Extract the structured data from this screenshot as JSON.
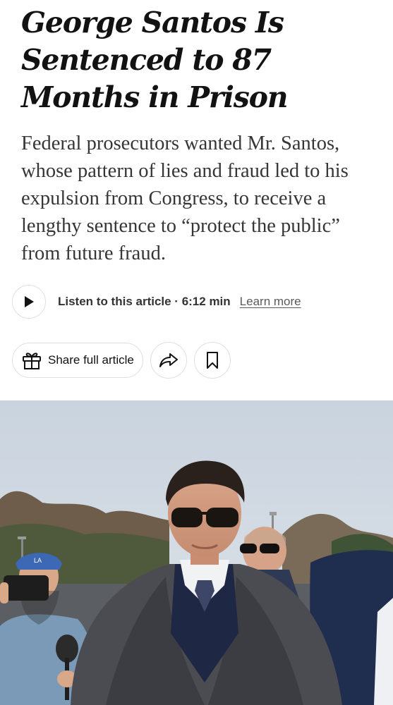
{
  "article": {
    "headline": "George Santos Is Sentenced to 87 Months in Prison",
    "summary": "Federal prosecutors wanted Mr. Santos, whose pattern of lies and fraud led to his expulsion from Congress, to receive a lengthy sentence to “protect the public” from future fraud."
  },
  "audio": {
    "play_icon": "play-icon",
    "listen_label": "Listen to this article · 6:12 min",
    "learn_more": "Learn more"
  },
  "actions": {
    "share_label": "Share full article",
    "gift_icon": "gift-icon",
    "share_icon": "share-arrow-icon",
    "save_icon": "bookmark-icon"
  },
  "photo": {
    "cap_lettering": "LA"
  }
}
